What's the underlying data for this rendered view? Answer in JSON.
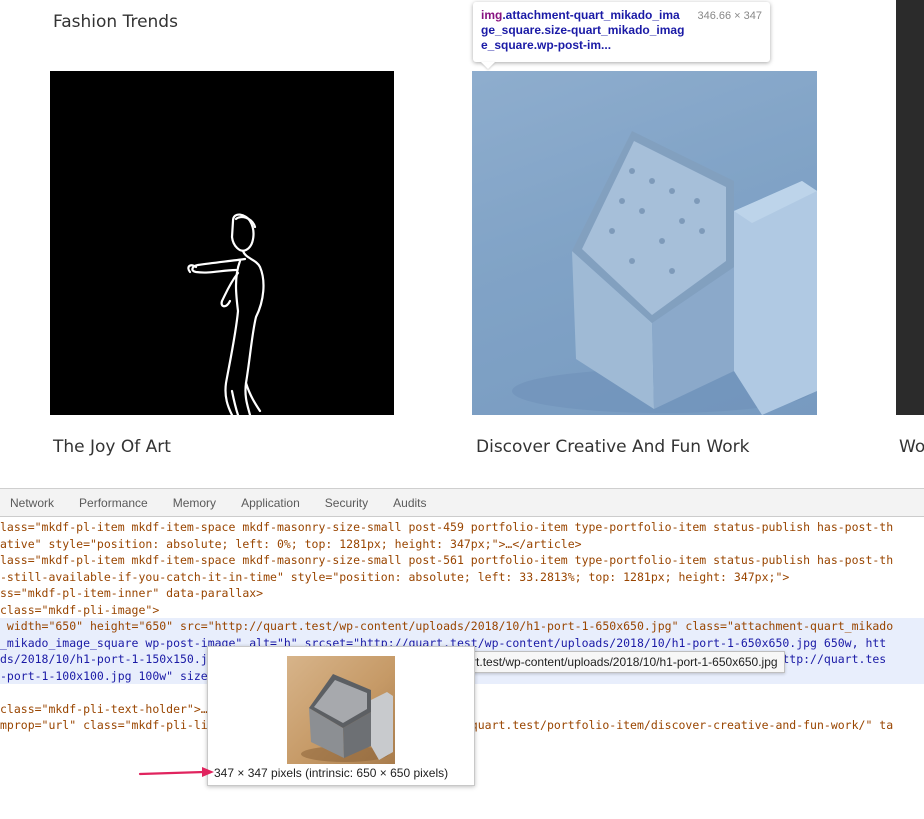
{
  "portfolio": {
    "titles": {
      "fashion": "Fashion Trends",
      "joy": "The Joy Of Art",
      "discover": "Discover Creative And Fun Work",
      "third_partial": "Wo"
    }
  },
  "element_tooltip": {
    "tag": "img",
    "classes": ".attachment-quart_mikado_image_square.size-quart_mikado_image_square.wp-post-im...",
    "size": "346.66 × 347"
  },
  "devtools": {
    "tabs": [
      "Network",
      "Performance",
      "Memory",
      "Application",
      "Security",
      "Audits"
    ],
    "url_tooltip": "http://quart.test/wp-content/uploads/2018/10/h1-port-1-650x650.jpg",
    "preview_caption": "347 × 347 pixels (intrinsic: 650 × 650 pixels)",
    "lines": {
      "l1": "lass=\"mkdf-pl-item mkdf-item-space mkdf-masonry-size-small post-459 portfolio-item type-portfolio-item status-publish has-post-th",
      "l2": "ative\" style=\"position: absolute; left: 0%; top: 1281px; height: 347px;\">…</article>",
      "l3": "lass=\"mkdf-pl-item mkdf-item-space mkdf-masonry-size-small post-561 portfolio-item type-portfolio-item status-publish has-post-th",
      "l4": "-still-available-if-you-catch-it-in-time\" style=\"position: absolute; left: 33.2813%; top: 1281px; height: 347px;\">",
      "l5": "ss=\"mkdf-pl-item-inner\" data-parallax>",
      "l6": "class=\"mkdf-pli-image\">",
      "l7": " width=\"650\" height=\"650\" src=\"http://quart.test/wp-content/uploads/2018/10/h1-port-1-650x650.jpg\" class=\"attachment-quart_mikado",
      "l8": "_mikado_image_square wp-post-image\" alt=\"h\" srcset=\"http://quart.test/wp-content/uploads/2018/10/h1-port-1-650x650.jpg 650w, htt",
      "l9": "ds/2018/10/h1-port-1-150x150.jpg 150w, http://quart.test/wp-content/uploads/2018/10/h1-port-1-300x300.jpg 300w, http://quart.tes",
      "l10": "-port-1-100x100.jpg 100w\" sizes=\"(max-width: 650px) 100vw, 650px\">",
      "l11": "",
      "l12": "class=\"mkdf-pli-text-holder\">…</div>",
      "l13": "mprop=\"url\" class=\"mkdf-pli-link mkdf-block-drag-link\" href=\"http://quart.test/portfolio-item/discover-creative-and-fun-work/\" ta"
    }
  },
  "colors": {
    "annotation_arrow": "#e0245e",
    "image_overlay": "#6fa8dc"
  }
}
